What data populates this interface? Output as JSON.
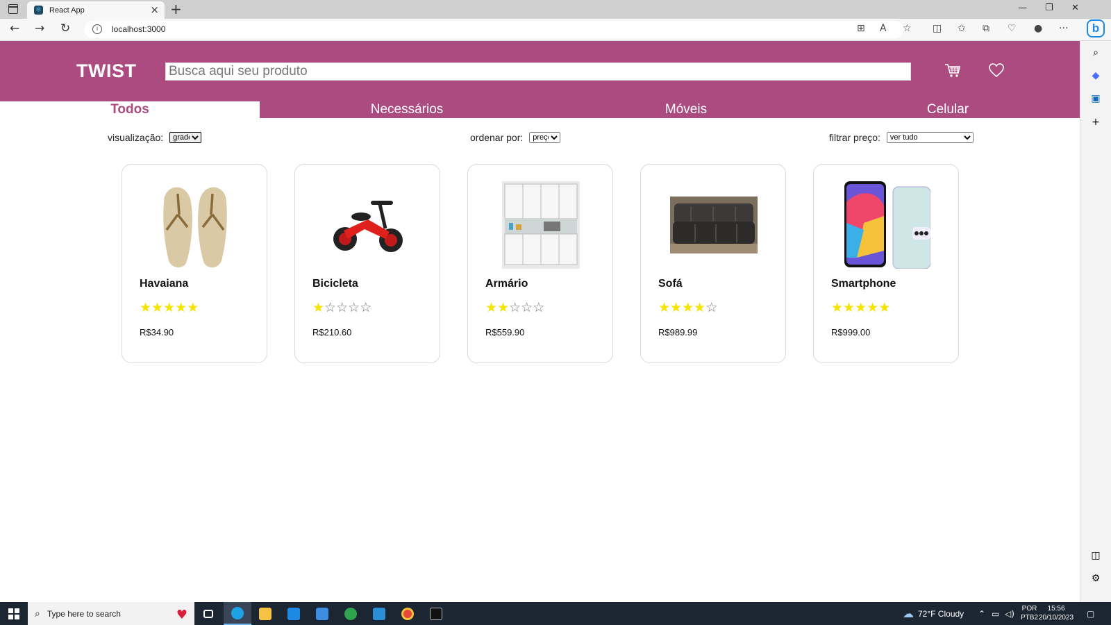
{
  "browser": {
    "tab_title": "React App",
    "url": "localhost:3000"
  },
  "header": {
    "logo": "TWIST",
    "search_placeholder": "Busca aqui seu produto",
    "background_color": "#ac4b80"
  },
  "categories": [
    {
      "label": "Todos",
      "active": true
    },
    {
      "label": "Necessários",
      "active": false
    },
    {
      "label": "Móveis",
      "active": false
    },
    {
      "label": "Celular",
      "active": false
    }
  ],
  "controls": {
    "view_label": "visualização:",
    "view_value": "grade",
    "sort_label": "ordenar por:",
    "sort_value": "preço",
    "filter_label": "filtrar preço:",
    "filter_value": "ver tudo"
  },
  "products": [
    {
      "name": "Havaiana",
      "rating": 5,
      "max_rating": 5,
      "price": "R$34.90",
      "image": "sandals"
    },
    {
      "name": "Bicicleta",
      "rating": 1,
      "max_rating": 5,
      "price": "R$210.60",
      "image": "balance-bike"
    },
    {
      "name": "Armário",
      "rating": 2,
      "max_rating": 5,
      "price": "R$559.90",
      "image": "kitchen-cabinet"
    },
    {
      "name": "Sofá",
      "rating": 4,
      "max_rating": 5,
      "price": "R$989.99",
      "image": "sofa"
    },
    {
      "name": "Smartphone",
      "rating": 5,
      "max_rating": 5,
      "price": "R$999.00",
      "image": "smartphone"
    }
  ],
  "taskbar": {
    "search_placeholder": "Type here to search",
    "weather": "72°F  Cloudy",
    "lang_line1": "POR",
    "lang_line2": "PTB2",
    "time": "15:56",
    "date": "20/10/2023"
  }
}
